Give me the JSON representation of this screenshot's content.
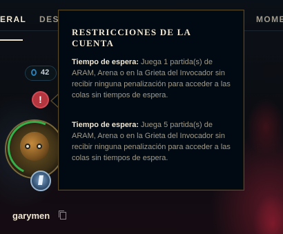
{
  "tabs": [
    {
      "label": "ERAL",
      "active": true
    },
    {
      "label": "DESA",
      "active": false
    },
    {
      "label": "MOME",
      "active": false
    }
  ],
  "profile": {
    "level": "42",
    "username": "garymen"
  },
  "tooltip": {
    "title": "RESTRICCIONES DE LA CUENTA",
    "entries": [
      {
        "label": "Tiempo de espera:",
        "text": " Juega 1 partida(s) de ARAM, Arena o en la Grieta del Invocador sin recibir ninguna penalización para acceder a las colas sin tiempos de espera."
      },
      {
        "label": "Tiempo de espera:",
        "text": " Juega 5 partida(s) de ARAM, Arena o en la Grieta del Invocador sin recibir ninguna penalización para acceder a las colas sin tiempos de espera."
      }
    ]
  },
  "icons": {
    "warning": "!",
    "copy": "copy-icon"
  },
  "colors": {
    "gold_text": "#f0e6d2",
    "body_text": "#a09b8c",
    "warning_red": "#b3353e",
    "tooltip_border": "#5b4a2a"
  }
}
